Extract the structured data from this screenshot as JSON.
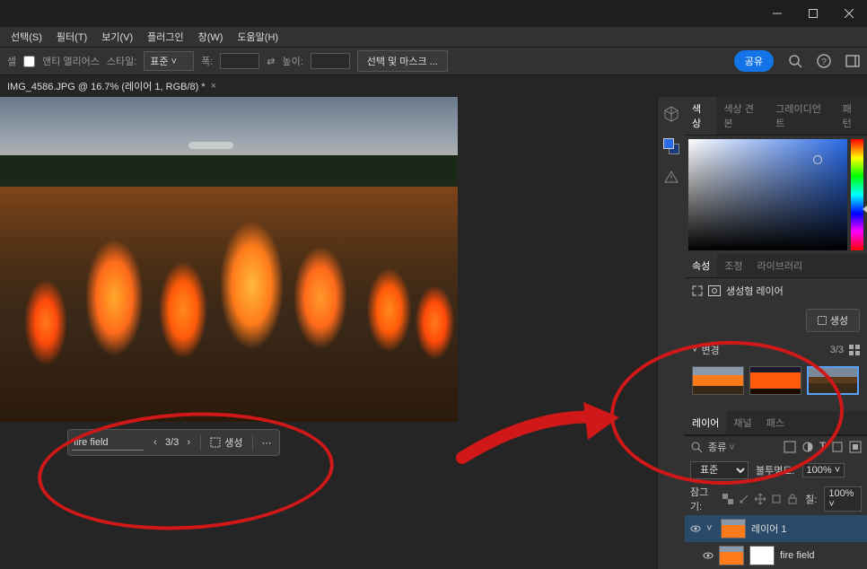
{
  "menu": [
    "선택(S)",
    "필터(T)",
    "보기(V)",
    "플러그인",
    "창(W)",
    "도움말(H)"
  ],
  "optbar": {
    "aa_label": "앤티 앨리어스",
    "style_label": "스타일:",
    "style_value": "표준",
    "width_label": "폭:",
    "height_label": "높이:",
    "mask_btn": "선택 및 마스크 ...",
    "share": "공유",
    "tool_label": "셀"
  },
  "doctab": "IMG_4586.JPG @ 16.7% (레이어 1, RGB/8) *",
  "genbar": {
    "prompt": "fire field",
    "counter": "3/3",
    "generate": "생성"
  },
  "panel_tabs_color": [
    "색상",
    "색상 견본",
    "그레이디언트",
    "패턴"
  ],
  "panel_tabs_props": [
    "속성",
    "조정",
    "라이브러리"
  ],
  "props": {
    "title": "생성형 레이어",
    "generate_btn": "생성",
    "variations": "변경",
    "var_count": "3/3"
  },
  "layers": {
    "tabs": [
      "레이어",
      "채널",
      "패스"
    ],
    "search": "종류",
    "blend": "표준",
    "opacity_label": "불투명도:",
    "opacity_value": "100%",
    "lock_label": "잠그기:",
    "fill_label": "칠:",
    "fill_value": "100%",
    "layer1": "레이어 1",
    "sublayer": "fire field"
  }
}
